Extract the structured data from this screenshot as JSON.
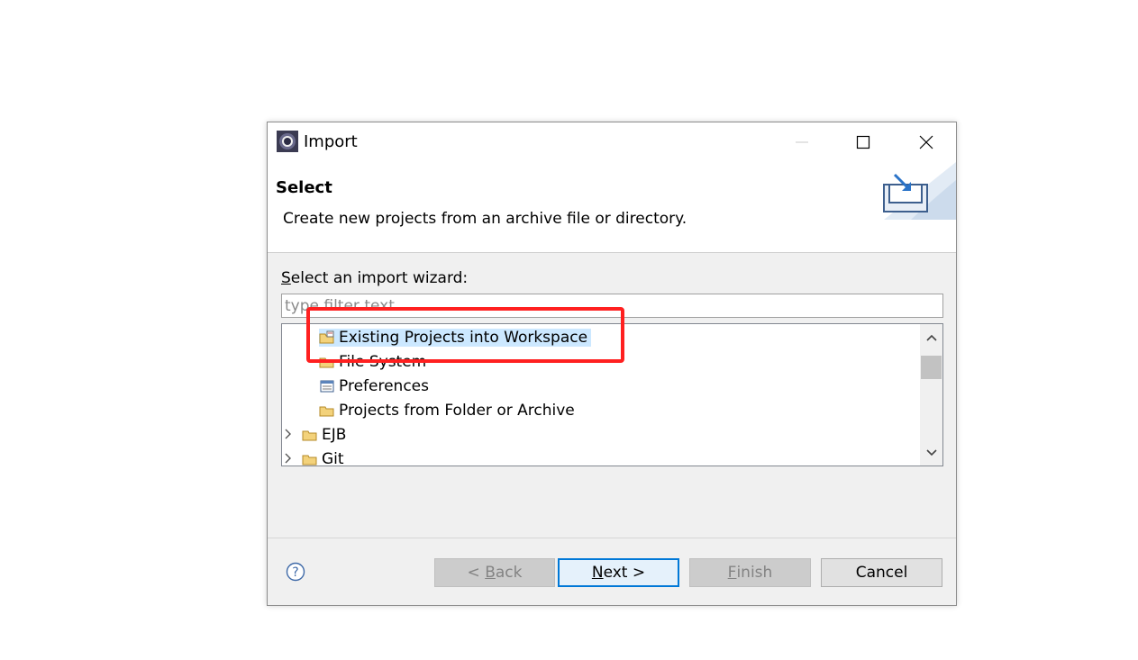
{
  "window": {
    "title": "Import",
    "icon": "eclipse-icon"
  },
  "header": {
    "title": "Select",
    "description": "Create new projects from an archive file or directory.",
    "graphic": "import-wizard-icon"
  },
  "wizard": {
    "label": "Select an import wizard:",
    "label_mnemonic": "S",
    "label_rest": "elect an import wizard:",
    "filter_placeholder": "type filter text",
    "filter_value": ""
  },
  "tree": {
    "items": [
      {
        "label": "Existing Projects into Workspace",
        "icon": "project-folder-icon",
        "selected": true
      },
      {
        "label": "File System",
        "icon": "folder-icon"
      },
      {
        "label": "Preferences",
        "icon": "preferences-icon"
      },
      {
        "label": "Projects from Folder or Archive",
        "icon": "folder-icon"
      },
      {
        "label": "EJB",
        "icon": "folder-icon",
        "collapsed": true
      },
      {
        "label": "Git",
        "icon": "folder-icon",
        "collapsed": true
      }
    ]
  },
  "buttons": {
    "back": {
      "prefix": "< ",
      "mnemonic": "B",
      "rest": "ack",
      "enabled": false
    },
    "next": {
      "mnemonic": "N",
      "rest": "ext >",
      "enabled": true
    },
    "finish": {
      "mnemonic": "F",
      "rest": "inish",
      "enabled": false
    },
    "cancel": {
      "label": "Cancel",
      "enabled": true
    }
  },
  "colors": {
    "selection": "#cce8ff",
    "highlight_annotation": "#ff2020",
    "default_button_border": "#0078d7"
  }
}
